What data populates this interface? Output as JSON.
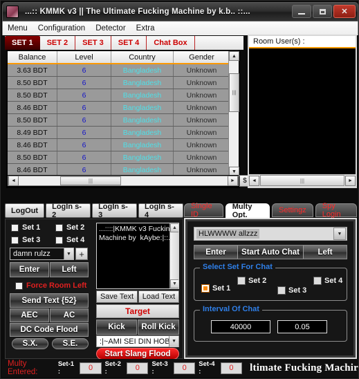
{
  "window": {
    "title": "...::  KMMK v3  || The Ultimate Fucking Machine  by k.b..  ::...",
    "minimize_label": "Minimize",
    "maximize_label": "Maximize",
    "close_label": "✕"
  },
  "menubar": {
    "items": [
      {
        "label": "Menu"
      },
      {
        "label": "Configuration"
      },
      {
        "label": "Detector"
      },
      {
        "label": "Extra"
      }
    ]
  },
  "set_tabs": [
    {
      "label": "SET 1",
      "active": true
    },
    {
      "label": "SET 2",
      "active": false
    },
    {
      "label": "SET 3",
      "active": false
    },
    {
      "label": "SET 4",
      "active": false
    },
    {
      "label": "Chat Box",
      "active": false
    }
  ],
  "table": {
    "columns": [
      "Balance",
      "Level",
      "Country",
      "Gender"
    ],
    "rows": [
      [
        "3.63 BDT",
        "6",
        "Bangladesh",
        "Unknown"
      ],
      [
        "8.50 BDT",
        "6",
        "Bangladesh",
        "Unknown"
      ],
      [
        "8.50 BDT",
        "6",
        "Bangladesh",
        "Unknown"
      ],
      [
        "8.46 BDT",
        "6",
        "Bangladesh",
        "Unknown"
      ],
      [
        "8.50 BDT",
        "6",
        "Bangladesh",
        "Unknown"
      ],
      [
        "8.49 BDT",
        "6",
        "Bangladesh",
        "Unknown"
      ],
      [
        "8.46 BDT",
        "6",
        "Bangladesh",
        "Unknown"
      ],
      [
        "8.50 BDT",
        "6",
        "Bangladesh",
        "Unknown"
      ],
      [
        "8.46 BDT",
        "6",
        "Bangladesh",
        "Unknown"
      ]
    ],
    "currency_button": "$",
    "scroll_up": "▲",
    "scroll_down": "▼",
    "scroll_left": "◄",
    "scroll_right": "►",
    "thumb_grip": "|||"
  },
  "room_panel": {
    "title": "Room User(s) :",
    "scroll_left": "◄",
    "scroll_right": "►",
    "thumb_grip": "|||"
  },
  "login_buttons": [
    {
      "label": "LogOut"
    },
    {
      "label": "LogIn s-2"
    },
    {
      "label": "LogIn s-3"
    },
    {
      "label": "LogIn s-4"
    }
  ],
  "left_panel": {
    "set_checkboxes": [
      {
        "label": "Set 1",
        "checked": false
      },
      {
        "label": "Set 2",
        "checked": false
      },
      {
        "label": "Set 3",
        "checked": false
      },
      {
        "label": "Set 4",
        "checked": false
      }
    ],
    "room_combo_value": "damn rulzz",
    "combo_arrow": "▼",
    "add_button": "+",
    "enter_label": "Enter",
    "left_label": "Left",
    "force_room_left": {
      "label": "Force Room Left",
      "checked": false
    },
    "send_text_label": "Send Text  {52}",
    "aec_label": "AEC",
    "ac_label": "AC",
    "dc_code_flood_label": "DC Code Flood",
    "sx_label": "S.X.",
    "se_label": "S.E.",
    "textarea_value": "...::::|KMMK v3 Fucking Machine by  kAybe:|::....",
    "textarea_scroll_up": "▲",
    "textarea_scroll_down": "▼",
    "save_text_label": "Save Text",
    "load_text_label": "Load Text",
    "target_label": "Target",
    "kick_label": "Kick",
    "roll_kick_label": "Roll Kick",
    "slang_combo_value": ":|~AMI SEI DIN HOB",
    "start_slang_flood_label": "Start Slang Flood"
  },
  "right_tabs": [
    {
      "label": "Single ID",
      "active": false
    },
    {
      "label": "Multy Opt.",
      "active": true
    },
    {
      "label": "Settingz",
      "active": false
    },
    {
      "label": "Spy Login",
      "active": false
    }
  ],
  "right_panel": {
    "chat_combo_value": "HLWWWW allzzz",
    "combo_arrow": "▼",
    "enter_label": "Enter",
    "start_auto_chat_label": "Start Auto Chat",
    "left_label": "Left",
    "select_set_legend": "Select Set For Chat",
    "set_checkboxes": [
      {
        "label": "Set 1",
        "checked": true
      },
      {
        "label": "Set 2",
        "checked": false
      },
      {
        "label": "Set 3",
        "checked": false
      },
      {
        "label": "Set 4",
        "checked": false
      }
    ],
    "interval_legend": "Interval Of Chat",
    "interval_value_1": "40000",
    "interval_value_2": "0.05"
  },
  "statusbar": {
    "label": "Multy Entered:",
    "counters": [
      {
        "label": "Set-1 :",
        "value": "0"
      },
      {
        "label": "Set-2 :",
        "value": "0"
      },
      {
        "label": "Set-3 :",
        "value": "0"
      },
      {
        "label": "Set-4 :",
        "value": "0"
      }
    ],
    "marquee": "ltimate Fucking Machir"
  },
  "colors": {
    "accent_orange": "#ff9900",
    "accent_red": "#cc0000",
    "country_cyan": "#4ee0e8",
    "level_blue": "#1414c8",
    "legend_blue": "#2f7fe8"
  }
}
